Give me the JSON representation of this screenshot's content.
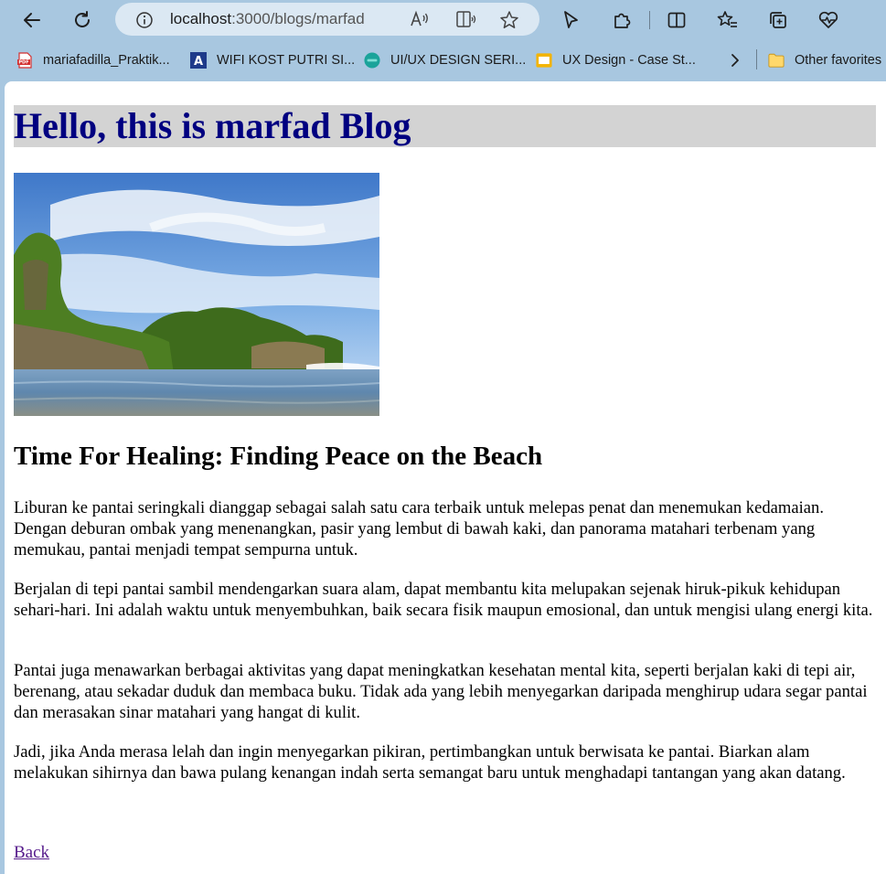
{
  "browser": {
    "url_host": "localhost",
    "url_path": ":3000/blogs/marfad",
    "bookmarks": [
      {
        "label": "mariafadilla_Praktik...",
        "icon": "pdf-icon"
      },
      {
        "label": "WIFI KOST PUTRI SI...",
        "icon": "letter-a-icon"
      },
      {
        "label": "UI/UX DESIGN SERI...",
        "icon": "myskill-icon"
      },
      {
        "label": "UX Design - Case St...",
        "icon": "slides-icon"
      }
    ],
    "other_favorites": "Other favorites"
  },
  "page": {
    "heading": "Hello, this is marfad Blog",
    "post_title": "Time For Healing: Finding Peace on the Beach",
    "paragraphs": [
      "Liburan ke pantai seringkali dianggap sebagai salah satu cara terbaik untuk melepas penat dan menemukan kedamaian. Dengan deburan ombak yang menenangkan, pasir yang lembut di bawah kaki, dan panorama matahari terbenam yang memukau, pantai menjadi tempat sempurna untuk.",
      "Berjalan di tepi pantai sambil mendengarkan suara alam, dapat membantu kita melupakan sejenak hiruk-pikuk kehidupan sehari-hari. Ini adalah waktu untuk menyembuhkan, baik secara fisik maupun emosional, dan untuk mengisi ulang energi kita.",
      "Pantai juga menawarkan berbagai aktivitas yang dapat meningkatkan kesehatan mental kita, seperti berjalan kaki di tepi air, berenang, atau sekadar duduk dan membaca buku. Tidak ada yang lebih menyegarkan daripada menghirup udara segar pantai dan merasakan sinar matahari yang hangat di kulit.",
      "Jadi, jika Anda merasa lelah dan ingin menyegarkan pikiran, pertimbangkan untuk berwisata ke pantai. Biarkan alam melakukan sihirnya dan bawa pulang kenangan indah serta semangat baru untuk menghadapi tantangan yang akan datang."
    ],
    "back_link": "Back"
  },
  "colors": {
    "heading": "#000080",
    "banner_bg": "#d3d3d3",
    "chrome_bg": "#a8c7e0",
    "visited_link": "#551a8b"
  }
}
